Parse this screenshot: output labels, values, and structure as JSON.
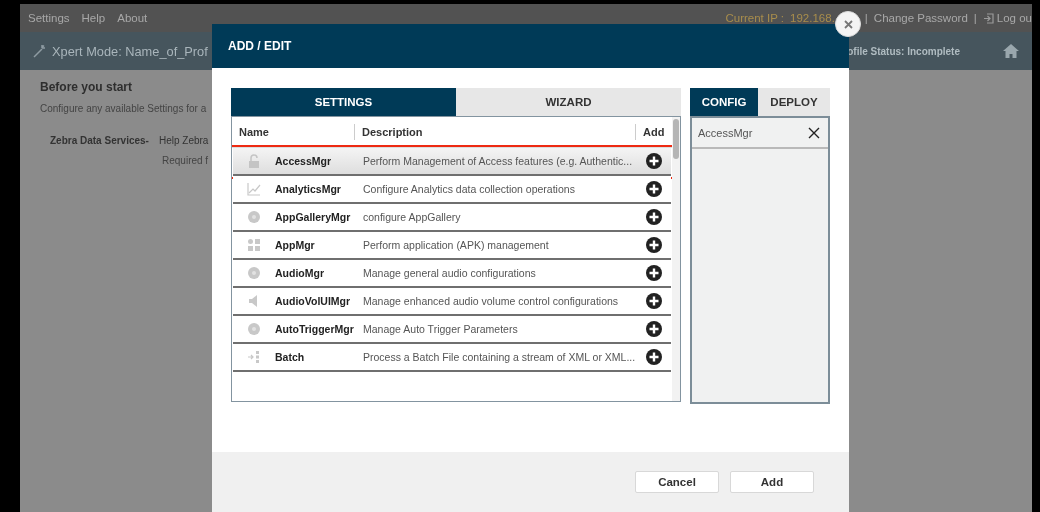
{
  "top_bar": {
    "menu": [
      "Settings",
      "Help",
      "About"
    ],
    "items": [
      {
        "kind": "ip_label",
        "text": "Current IP :"
      },
      {
        "kind": "ip",
        "text": "192.168."
      },
      {
        "kind": "separator",
        "text": "|"
      },
      {
        "kind": "link",
        "text": "Change Password"
      },
      {
        "kind": "separator",
        "text": "|"
      },
      {
        "kind": "logout",
        "text": "Log ou"
      }
    ]
  },
  "header": {
    "title": "Xpert Mode: Name_of_Prof",
    "status": "ofile Status: Incomplete"
  },
  "content": {
    "heading": "Before you start",
    "intro": "Configure any available Settings for a",
    "services_label": "Zebra Data Services-",
    "services_text": "Help Zebra",
    "required_text": "Required f"
  },
  "dialog": {
    "title": "ADD / EDIT",
    "tabs": [
      {
        "label": "SETTINGS",
        "selected": true
      },
      {
        "label": "WIZARD",
        "selected": false
      }
    ],
    "columns": [
      "Name",
      "Description",
      "Add"
    ],
    "rows": [
      {
        "kind": "lock",
        "name": "AccessMgr",
        "description": "Perform Management of Access features (e.g. Authentic...",
        "selected": true
      },
      {
        "kind": "chart",
        "name": "AnalyticsMgr",
        "description": "Configure Analytics data collection operations",
        "selected": false
      },
      {
        "kind": "sn",
        "name": "AppGalleryMgr",
        "description": "configure AppGallery",
        "selected": false
      },
      {
        "kind": "apps",
        "name": "AppMgr",
        "description": "Perform application (APK) management",
        "selected": false
      },
      {
        "kind": "sn",
        "name": "AudioMgr",
        "description": "Manage general audio configurations",
        "selected": false
      },
      {
        "kind": "speaker",
        "name": "AudioVolUIMgr",
        "description": "Manage enhanced audio volume control configurations",
        "selected": false
      },
      {
        "kind": "sn",
        "name": "AutoTriggerMgr",
        "description": "Manage Auto Trigger Parameters",
        "selected": false
      },
      {
        "kind": "batch",
        "name": "Batch",
        "description": "Process a Batch File containing a stream of XML or XML...",
        "selected": false
      }
    ],
    "side_tabs": [
      {
        "label": "CONFIG",
        "selected": true
      },
      {
        "label": "DEPLOY",
        "selected": false
      }
    ],
    "config_items": [
      "AccessMgr"
    ],
    "buttons": [
      "Cancel",
      "Add"
    ]
  }
}
